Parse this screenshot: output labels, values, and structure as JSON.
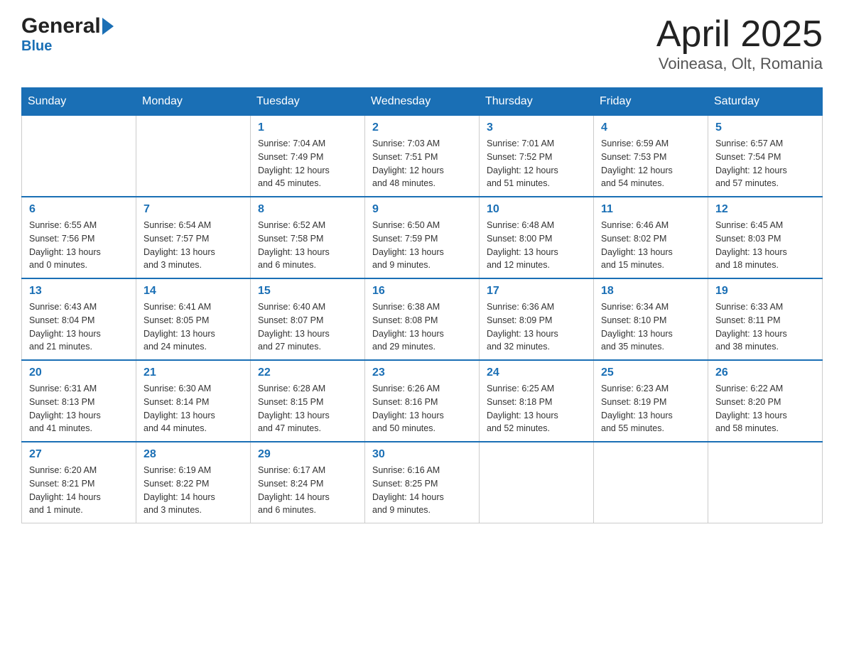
{
  "logo": {
    "part1": "General",
    "part2": "Blue"
  },
  "title": "April 2025",
  "subtitle": "Voineasa, Olt, Romania",
  "days_of_week": [
    "Sunday",
    "Monday",
    "Tuesday",
    "Wednesday",
    "Thursday",
    "Friday",
    "Saturday"
  ],
  "weeks": [
    [
      {
        "num": "",
        "info": ""
      },
      {
        "num": "",
        "info": ""
      },
      {
        "num": "1",
        "info": "Sunrise: 7:04 AM\nSunset: 7:49 PM\nDaylight: 12 hours\nand 45 minutes."
      },
      {
        "num": "2",
        "info": "Sunrise: 7:03 AM\nSunset: 7:51 PM\nDaylight: 12 hours\nand 48 minutes."
      },
      {
        "num": "3",
        "info": "Sunrise: 7:01 AM\nSunset: 7:52 PM\nDaylight: 12 hours\nand 51 minutes."
      },
      {
        "num": "4",
        "info": "Sunrise: 6:59 AM\nSunset: 7:53 PM\nDaylight: 12 hours\nand 54 minutes."
      },
      {
        "num": "5",
        "info": "Sunrise: 6:57 AM\nSunset: 7:54 PM\nDaylight: 12 hours\nand 57 minutes."
      }
    ],
    [
      {
        "num": "6",
        "info": "Sunrise: 6:55 AM\nSunset: 7:56 PM\nDaylight: 13 hours\nand 0 minutes."
      },
      {
        "num": "7",
        "info": "Sunrise: 6:54 AM\nSunset: 7:57 PM\nDaylight: 13 hours\nand 3 minutes."
      },
      {
        "num": "8",
        "info": "Sunrise: 6:52 AM\nSunset: 7:58 PM\nDaylight: 13 hours\nand 6 minutes."
      },
      {
        "num": "9",
        "info": "Sunrise: 6:50 AM\nSunset: 7:59 PM\nDaylight: 13 hours\nand 9 minutes."
      },
      {
        "num": "10",
        "info": "Sunrise: 6:48 AM\nSunset: 8:00 PM\nDaylight: 13 hours\nand 12 minutes."
      },
      {
        "num": "11",
        "info": "Sunrise: 6:46 AM\nSunset: 8:02 PM\nDaylight: 13 hours\nand 15 minutes."
      },
      {
        "num": "12",
        "info": "Sunrise: 6:45 AM\nSunset: 8:03 PM\nDaylight: 13 hours\nand 18 minutes."
      }
    ],
    [
      {
        "num": "13",
        "info": "Sunrise: 6:43 AM\nSunset: 8:04 PM\nDaylight: 13 hours\nand 21 minutes."
      },
      {
        "num": "14",
        "info": "Sunrise: 6:41 AM\nSunset: 8:05 PM\nDaylight: 13 hours\nand 24 minutes."
      },
      {
        "num": "15",
        "info": "Sunrise: 6:40 AM\nSunset: 8:07 PM\nDaylight: 13 hours\nand 27 minutes."
      },
      {
        "num": "16",
        "info": "Sunrise: 6:38 AM\nSunset: 8:08 PM\nDaylight: 13 hours\nand 29 minutes."
      },
      {
        "num": "17",
        "info": "Sunrise: 6:36 AM\nSunset: 8:09 PM\nDaylight: 13 hours\nand 32 minutes."
      },
      {
        "num": "18",
        "info": "Sunrise: 6:34 AM\nSunset: 8:10 PM\nDaylight: 13 hours\nand 35 minutes."
      },
      {
        "num": "19",
        "info": "Sunrise: 6:33 AM\nSunset: 8:11 PM\nDaylight: 13 hours\nand 38 minutes."
      }
    ],
    [
      {
        "num": "20",
        "info": "Sunrise: 6:31 AM\nSunset: 8:13 PM\nDaylight: 13 hours\nand 41 minutes."
      },
      {
        "num": "21",
        "info": "Sunrise: 6:30 AM\nSunset: 8:14 PM\nDaylight: 13 hours\nand 44 minutes."
      },
      {
        "num": "22",
        "info": "Sunrise: 6:28 AM\nSunset: 8:15 PM\nDaylight: 13 hours\nand 47 minutes."
      },
      {
        "num": "23",
        "info": "Sunrise: 6:26 AM\nSunset: 8:16 PM\nDaylight: 13 hours\nand 50 minutes."
      },
      {
        "num": "24",
        "info": "Sunrise: 6:25 AM\nSunset: 8:18 PM\nDaylight: 13 hours\nand 52 minutes."
      },
      {
        "num": "25",
        "info": "Sunrise: 6:23 AM\nSunset: 8:19 PM\nDaylight: 13 hours\nand 55 minutes."
      },
      {
        "num": "26",
        "info": "Sunrise: 6:22 AM\nSunset: 8:20 PM\nDaylight: 13 hours\nand 58 minutes."
      }
    ],
    [
      {
        "num": "27",
        "info": "Sunrise: 6:20 AM\nSunset: 8:21 PM\nDaylight: 14 hours\nand 1 minute."
      },
      {
        "num": "28",
        "info": "Sunrise: 6:19 AM\nSunset: 8:22 PM\nDaylight: 14 hours\nand 3 minutes."
      },
      {
        "num": "29",
        "info": "Sunrise: 6:17 AM\nSunset: 8:24 PM\nDaylight: 14 hours\nand 6 minutes."
      },
      {
        "num": "30",
        "info": "Sunrise: 6:16 AM\nSunset: 8:25 PM\nDaylight: 14 hours\nand 9 minutes."
      },
      {
        "num": "",
        "info": ""
      },
      {
        "num": "",
        "info": ""
      },
      {
        "num": "",
        "info": ""
      }
    ]
  ]
}
